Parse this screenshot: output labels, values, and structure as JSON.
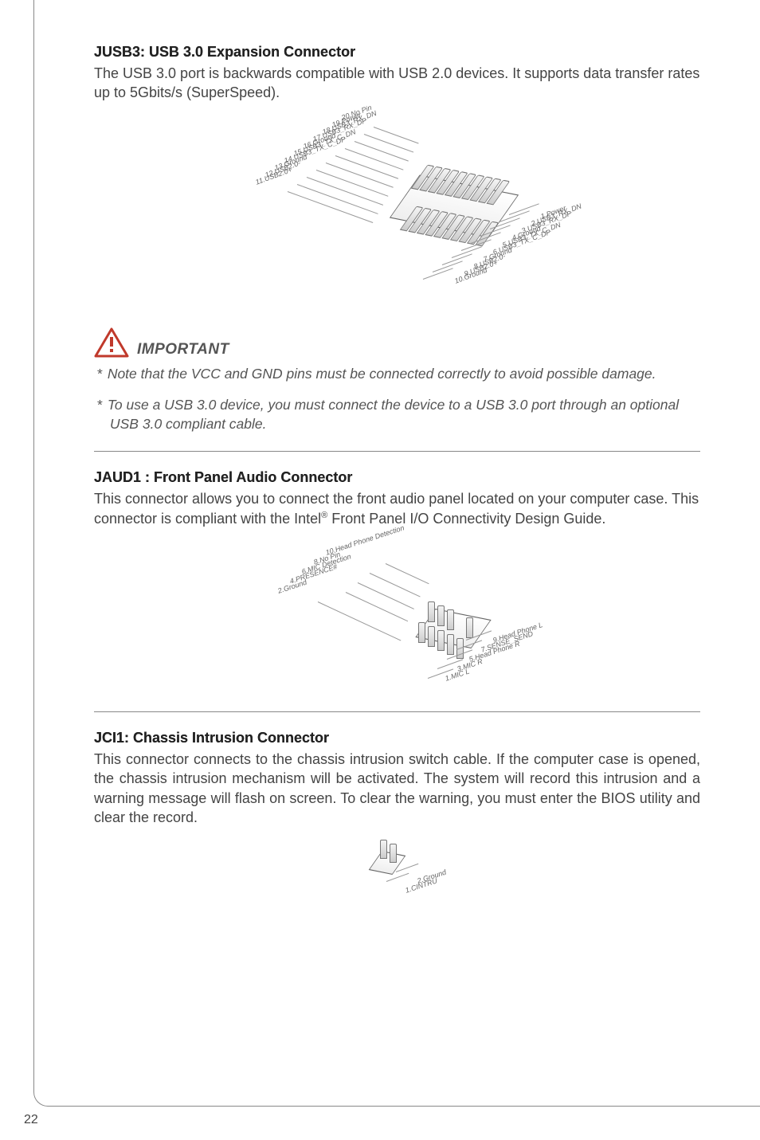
{
  "page_number": "22",
  "section1": {
    "heading": "JUSB3: USB 3.0 Expansion Connector",
    "body": "The USB 3.0 port is backwards compatible with USB 2.0 devices. It supports data transfer rates up to 5Gbits/s (SuperSpeed).",
    "pins_left": [
      "20.No Pin",
      "19.Power",
      "18.USB3_RX_DN",
      "17.USB3_RX_DP",
      "16.Ground",
      "15.USB3_TX_C_DN",
      "14.USB3_TX_C_DP",
      "13.Ground",
      "12.USB2.0-",
      "11.USB2.0+"
    ],
    "pins_right": [
      "1.Power",
      "2.USB3_RX_DN",
      "3.USB3_RX_DP",
      "4.Ground",
      "5.USB3_TX_C_DN",
      "6.USB3_TX_C_DP",
      "7.Ground",
      "8.USB2.0-",
      "9.USB2.0+",
      "10.Ground"
    ]
  },
  "important": {
    "label": "IMPORTANT",
    "note1": "Note that the VCC and GND pins must be connected correctly to avoid possible damage.",
    "note2": "To use a USB 3.0 device, you must connect the device to a USB 3.0 port through an optional USB 3.0 compliant cable."
  },
  "section2": {
    "heading": "JAUD1 : Front Panel Audio Connector",
    "body_pre": "This connector allows you to connect the front audio panel located on your computer case. This connector is compliant with the Intel",
    "body_post": " Front Panel I/O Connectivity Design Guide.",
    "reg": "®",
    "pins_left": [
      "10.Head Phone Detection",
      "8.No Pin",
      "6.MIC Detection",
      "4.PRESENCE#",
      "2.Ground"
    ],
    "pins_right": [
      "9.Head Phone L",
      "7.SENSE_SEND",
      "5.Head Phone R",
      "3.MIC R",
      "1.MIC L"
    ]
  },
  "section3": {
    "heading": "JCI1: Chassis Intrusion Connector",
    "body": "This connector connects to the chassis intrusion switch cable. If the computer case is opened, the chassis intrusion mechanism will be activated. The system will record this intrusion and a warning message will flash on screen. To clear the warning, you must enter the BIOS utility and clear the record.",
    "pins": [
      "2.Ground",
      "1.CINTRU"
    ]
  }
}
